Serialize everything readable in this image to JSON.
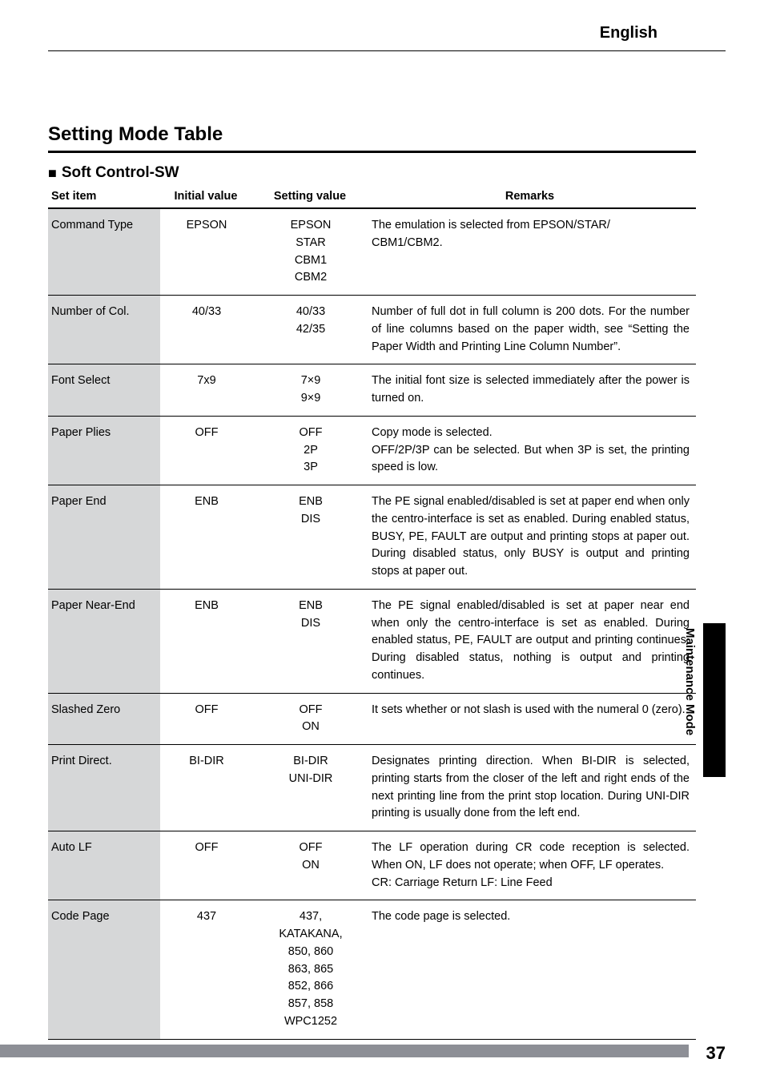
{
  "header": {
    "language": "English"
  },
  "section_title": "Setting Mode Table",
  "subsection_title": "Soft Control-SW",
  "columns": {
    "set_item": "Set item",
    "initial_value": "Initial value",
    "setting_value": "Setting value",
    "remarks": "Remarks"
  },
  "rows": [
    {
      "set_item": "Command Type",
      "initial": "EPSON",
      "setting": "EPSON\nSTAR\nCBM1\nCBM2",
      "remarks": "The emulation is selected from EPSON/STAR/\nCBM1/CBM2."
    },
    {
      "set_item": "Number of Col.",
      "initial": "40/33",
      "setting": "40/33\n42/35",
      "remarks": "Number of full dot in full column is 200 dots. For the number of line columns based on the paper width, see “Setting the Paper Width and Printing Line Column Number”."
    },
    {
      "set_item": "Font Select",
      "initial": "7x9",
      "setting": "7×9\n9×9",
      "remarks": "The initial font size is selected immediately after the power is turned on."
    },
    {
      "set_item": "Paper Plies",
      "initial": "OFF",
      "setting": "OFF\n2P\n3P",
      "remarks": "Copy mode is selected.\nOFF/2P/3P can be selected. But when 3P is set, the printing speed is low."
    },
    {
      "set_item": "Paper End",
      "initial": "ENB",
      "setting": "ENB\nDIS",
      "remarks": "The PE signal enabled/disabled is set at paper end when only the centro-interface is set as enabled. During enabled status, BUSY, PE, FAULT are output and printing stops at paper out. During disabled status, only BUSY is output and printing stops at paper out."
    },
    {
      "set_item": "Paper Near-End",
      "initial": "ENB",
      "setting": "ENB\nDIS",
      "remarks": "The PE signal enabled/disabled is set at paper near end when only the centro-interface is set as enabled. During enabled status, PE, FAULT are output and printing continues. During disabled status, nothing is output and printing continues."
    },
    {
      "set_item": "Slashed Zero",
      "initial": "OFF",
      "setting": "OFF\nON",
      "remarks": "It sets whether or not slash is used with the numeral 0 (zero)."
    },
    {
      "set_item": "Print Direct.",
      "initial": "BI-DIR",
      "setting": "BI-DIR\nUNI-DIR",
      "remarks": "Designates printing direction. When BI-DIR is selected, printing starts from the closer of the left and right ends of the next printing line from the print stop location. During UNI-DIR printing is usually done from the left end."
    },
    {
      "set_item": "Auto LF",
      "initial": "OFF",
      "setting": "OFF\nON",
      "remarks": "The LF operation during CR code reception is selected. When ON, LF does not operate; when OFF, LF operates.\nCR: Carriage Return LF: Line Feed"
    },
    {
      "set_item": "Code Page",
      "initial": "437",
      "setting": "437,\nKATAKANA,\n850, 860\n863, 865\n852, 866\n857, 858\nWPC1252",
      "remarks": "The code page is selected."
    }
  ],
  "side_label": "Maintenance Mode",
  "page_number": "37"
}
